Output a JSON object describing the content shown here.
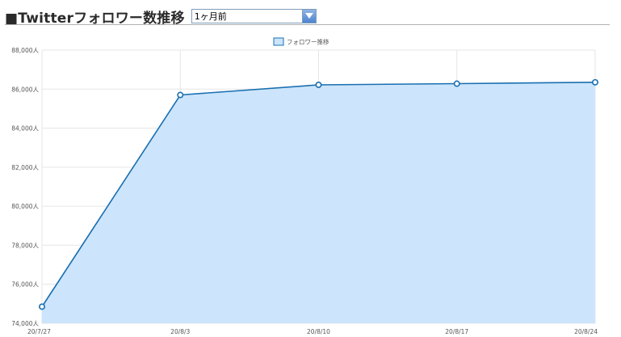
{
  "header": {
    "title": "■Twitterフォロワー数推移",
    "period_select": {
      "value": "1ヶ月前"
    }
  },
  "colors": {
    "line": "#1a6fb0",
    "area": "#cce5fc",
    "grid": "#e6e6e6"
  },
  "chart_data": {
    "type": "area",
    "x": [
      "20/7/27",
      "20/8/3",
      "20/8/10",
      "20/8/17",
      "20/8/24"
    ],
    "series": [
      {
        "name": "フォロワー推移",
        "values": [
          74850,
          85700,
          86220,
          86280,
          86350
        ]
      }
    ],
    "ylim": [
      74000,
      88000
    ],
    "yticks": [
      74000,
      76000,
      78000,
      80000,
      82000,
      84000,
      86000,
      88000
    ],
    "ytick_labels": [
      "74,000人",
      "76,000人",
      "78,000人",
      "80,000人",
      "82,000人",
      "84,000人",
      "86,000人",
      "88,000人"
    ],
    "grid": true,
    "legend": "top-center"
  }
}
